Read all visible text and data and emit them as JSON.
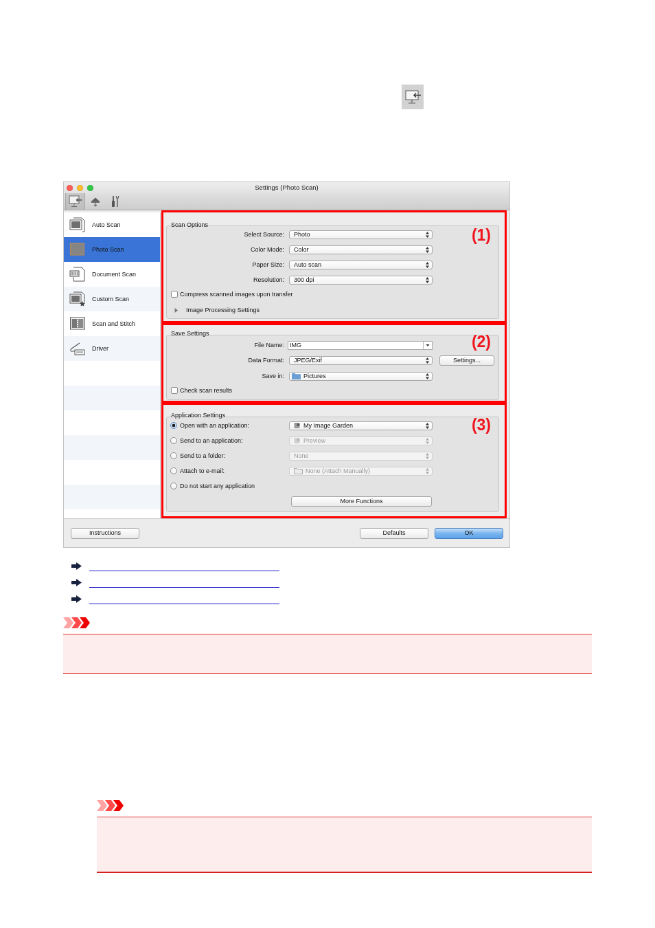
{
  "window": {
    "title": "Settings (Photo Scan)",
    "toolbar": [
      {
        "kind": "monitor",
        "selected": true
      },
      {
        "kind": "scanner",
        "selected": false
      },
      {
        "kind": "tools",
        "selected": false
      }
    ]
  },
  "sidebar": {
    "items": [
      {
        "label": "Auto Scan",
        "kind": "auto",
        "selected": false
      },
      {
        "label": "Photo Scan",
        "kind": "photo",
        "selected": true
      },
      {
        "label": "Document Scan",
        "kind": "document",
        "selected": false
      },
      {
        "label": "Custom Scan",
        "kind": "custom",
        "selected": false
      },
      {
        "label": "Scan and Stitch",
        "kind": "stitch",
        "selected": false
      },
      {
        "label": "Driver",
        "kind": "driver",
        "selected": false
      }
    ]
  },
  "scan_options": {
    "title": "Scan Options",
    "marker": "(1)",
    "fields": [
      {
        "label": "Select Source:",
        "value": "Photo"
      },
      {
        "label": "Color Mode:",
        "value": "Color"
      },
      {
        "label": "Paper Size:",
        "value": "Auto scan"
      },
      {
        "label": "Resolution:",
        "value": "300 dpi"
      }
    ],
    "compress": {
      "label": "Compress scanned images upon transfer",
      "checked": false
    },
    "image_processing": {
      "label": "Image Processing Settings",
      "expanded": false
    }
  },
  "save_settings": {
    "title": "Save Settings",
    "marker": "(2)",
    "file_name": {
      "label": "File Name:",
      "value": "IMG"
    },
    "data_format": {
      "label": "Data Format:",
      "value": "JPEG/Exif",
      "button": "Settings..."
    },
    "save_in": {
      "label": "Save in:",
      "value": "Pictures"
    },
    "check_results": {
      "label": "Check scan results",
      "checked": false
    }
  },
  "application_settings": {
    "title": "Application Settings",
    "marker": "(3)",
    "options": [
      {
        "label": "Open with an application:",
        "kind": "app",
        "selected": true,
        "value": "My Image Garden",
        "disabled": false
      },
      {
        "label": "Send to an application:",
        "kind": "app",
        "selected": false,
        "value": "Preview",
        "disabled": true
      },
      {
        "label": "Send to a folder:",
        "kind": "plain",
        "selected": false,
        "value": "None",
        "disabled": true
      },
      {
        "label": "Attach to e-mail:",
        "kind": "folder",
        "selected": false,
        "value": "None (Attach Manually)",
        "disabled": true
      },
      {
        "label": "Do not start any application",
        "kind": "none",
        "selected": false
      }
    ],
    "more_button": "More Functions"
  },
  "buttons": {
    "instructions": "Instructions",
    "defaults": "Defaults",
    "ok": "OK"
  },
  "related_links": [
    {
      "kind": "arrow-link"
    },
    {
      "kind": "arrow-link"
    },
    {
      "kind": "arrow-link"
    }
  ],
  "notes": [
    {
      "kind": "important",
      "indented": false
    },
    {
      "kind": "important",
      "indented": true
    }
  ]
}
